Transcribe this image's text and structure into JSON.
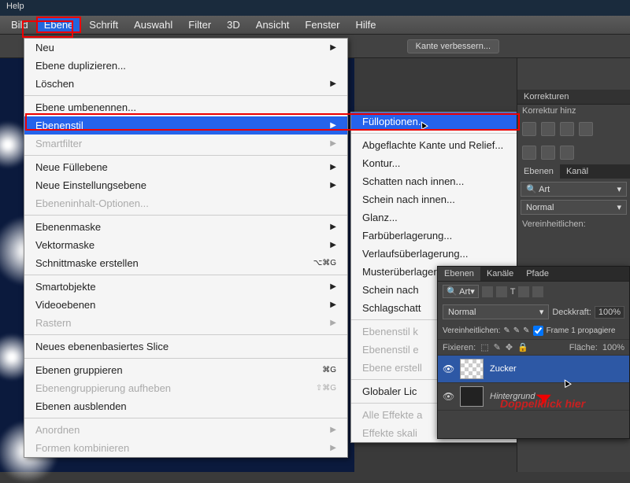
{
  "titlebar": "Help",
  "menubar": [
    "Bild",
    "Ebene",
    "Schrift",
    "Auswahl",
    "Filter",
    "3D",
    "Ansicht",
    "Fenster",
    "Hilfe"
  ],
  "menubar_highlight_index": 1,
  "toolbar": {
    "refine_edge": "Kante verbessern..."
  },
  "menu1": [
    {
      "t": "Neu",
      "sub": true
    },
    {
      "t": "Ebene duplizieren..."
    },
    {
      "t": "Löschen",
      "sub": true
    },
    {
      "sep": true
    },
    {
      "t": "Ebene umbenennen..."
    },
    {
      "t": "Ebenenstil",
      "sub": true,
      "hl": true
    },
    {
      "t": "Smartfilter",
      "sub": true,
      "dis": true
    },
    {
      "sep": true
    },
    {
      "t": "Neue Füllebene",
      "sub": true
    },
    {
      "t": "Neue Einstellungsebene",
      "sub": true
    },
    {
      "t": "Ebeneninhalt-Optionen...",
      "dis": true
    },
    {
      "sep": true
    },
    {
      "t": "Ebenenmaske",
      "sub": true
    },
    {
      "t": "Vektormaske",
      "sub": true
    },
    {
      "t": "Schnittmaske erstellen",
      "sc": "⌥⌘G"
    },
    {
      "sep": true
    },
    {
      "t": "Smartobjekte",
      "sub": true
    },
    {
      "t": "Videoebenen",
      "sub": true
    },
    {
      "t": "Rastern",
      "sub": true,
      "dis": true
    },
    {
      "sep": true
    },
    {
      "t": "Neues ebenenbasiertes Slice"
    },
    {
      "sep": true
    },
    {
      "t": "Ebenen gruppieren",
      "sc": "⌘G"
    },
    {
      "t": "Ebenengruppierung aufheben",
      "sc": "⇧⌘G",
      "dis": true
    },
    {
      "t": "Ebenen ausblenden"
    },
    {
      "sep": true
    },
    {
      "t": "Anordnen",
      "sub": true,
      "dis": true
    },
    {
      "t": "Formen kombinieren",
      "sub": true,
      "dis": true
    }
  ],
  "menu2": [
    {
      "t": "Fülloptionen...",
      "hl": true
    },
    {
      "sep": true
    },
    {
      "t": "Abgeflachte Kante und Relief..."
    },
    {
      "t": "Kontur..."
    },
    {
      "t": "Schatten nach innen..."
    },
    {
      "t": "Schein nach innen..."
    },
    {
      "t": "Glanz..."
    },
    {
      "t": "Farbüberlagerung..."
    },
    {
      "t": "Verlaufsüberlagerung..."
    },
    {
      "t": "Musterüberlagerung..."
    },
    {
      "t": "Schein nach"
    },
    {
      "t": "Schlagschatt"
    },
    {
      "sep": true
    },
    {
      "t": "Ebenenstil k",
      "dis": true
    },
    {
      "t": "Ebenenstil e",
      "dis": true
    },
    {
      "t": "Ebene erstell",
      "dis": true
    },
    {
      "sep": true
    },
    {
      "t": "Globaler Lic"
    },
    {
      "sep": true
    },
    {
      "t": "Alle Effekte a",
      "dis": true
    },
    {
      "t": "Effekte skali",
      "dis": true
    }
  ],
  "right_panels": {
    "corrections": "Korrekturen",
    "correction_hint": "Korrektur hinz",
    "layers_tab": "Ebenen",
    "channels_tab": "Kanäl",
    "kind": "Art",
    "blend_mode": "Normal",
    "unify": "Vereinheitlichen:"
  },
  "float_layers": {
    "tabs": [
      "Ebenen",
      "Kanäle",
      "Pfade"
    ],
    "kind_label": "Art",
    "blend_mode": "Normal",
    "opacity_label": "Deckkraft:",
    "opacity_val": "100%",
    "unify_label": "Vereinheitlichen:",
    "propagate": "Frame 1 propagiere",
    "lock_label": "Fixieren:",
    "fill_label": "Fläche:",
    "fill_val": "100%",
    "layers": [
      {
        "name": "Zucker",
        "sel": true,
        "checker": true
      },
      {
        "name": "Hintergrund",
        "ital": true
      }
    ]
  },
  "annotation": "Doppelklick hier"
}
